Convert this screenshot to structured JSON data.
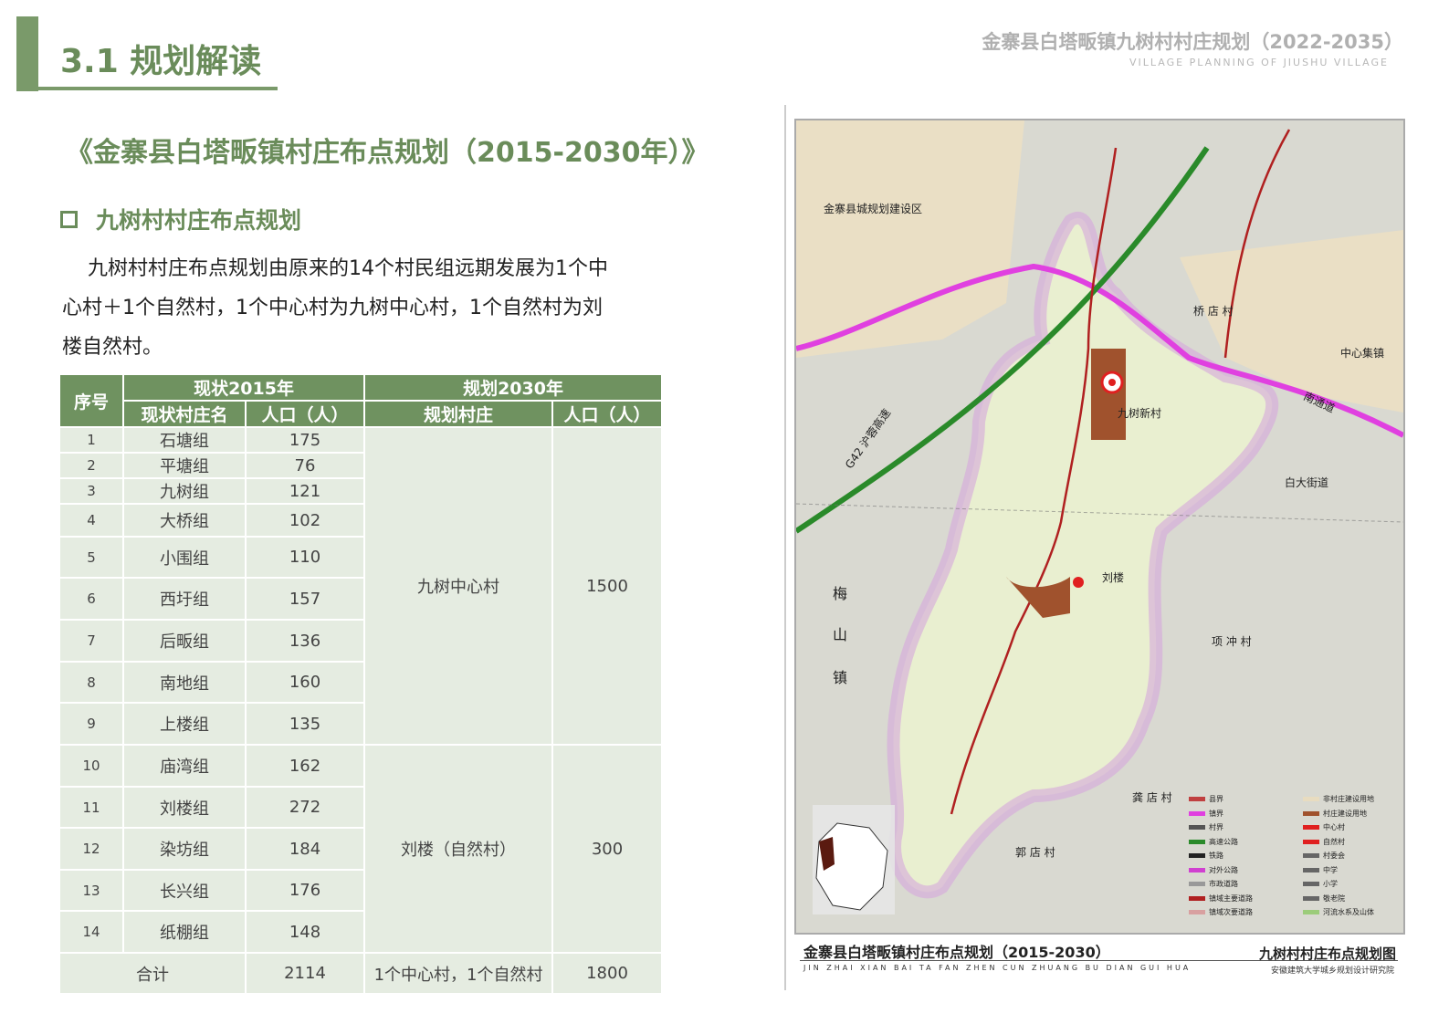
{
  "header": {
    "section_title": "3.1 规划解读",
    "doc_title": "金寨县白塔畈镇九树村村庄规划（2022-2035）",
    "doc_subtitle": "VILLAGE PLANNING OF JIUSHU VILLAGE"
  },
  "main_title": "《金寨县白塔畈镇村庄布点规划（2015-2030年）》",
  "sub_heading": "九树村村庄布点规划",
  "paragraph": {
    "line1": "九树村村庄布点规划由原来的14个村民组远期发展为1个中",
    "line2": "心村＋1个自然村，1个中心村为九树中心村，1个自然村为刘",
    "line3": "楼自然村。"
  },
  "table": {
    "headers": {
      "index": "序号",
      "current_group": "现状2015年",
      "planned_group": "规划2030年",
      "current_name": "现状村庄名",
      "current_pop": "人口（人）",
      "planned_name": "规划村庄",
      "planned_pop": "人口（人）"
    },
    "rows": [
      {
        "idx": "1",
        "name": "石塘组",
        "pop": "175"
      },
      {
        "idx": "2",
        "name": "平塘组",
        "pop": "76"
      },
      {
        "idx": "3",
        "name": "九树组",
        "pop": "121"
      },
      {
        "idx": "4",
        "name": "大桥组",
        "pop": "102"
      },
      {
        "idx": "5",
        "name": "小围组",
        "pop": "110"
      },
      {
        "idx": "6",
        "name": "西圩组",
        "pop": "157"
      },
      {
        "idx": "7",
        "name": "后畈组",
        "pop": "136"
      },
      {
        "idx": "8",
        "name": "南地组",
        "pop": "160"
      },
      {
        "idx": "9",
        "name": "上楼组",
        "pop": "135"
      },
      {
        "idx": "10",
        "name": "庙湾组",
        "pop": "162"
      },
      {
        "idx": "11",
        "name": "刘楼组",
        "pop": "272"
      },
      {
        "idx": "12",
        "name": "染坊组",
        "pop": "184"
      },
      {
        "idx": "13",
        "name": "长兴组",
        "pop": "176"
      },
      {
        "idx": "14",
        "name": "纸棚组",
        "pop": "148"
      }
    ],
    "planned": [
      {
        "name": "九树中心村",
        "pop": "1500"
      },
      {
        "name": "刘楼（自然村）",
        "pop": "300"
      }
    ],
    "total": {
      "label": "合计",
      "pop": "2114",
      "planned_name": "1个中心村，1个自然村",
      "planned_pop": "1800"
    }
  },
  "map": {
    "labels": {
      "county_area": "金寨县城规划建设区",
      "qiaodian": "桥 店 村",
      "zhongxinji": "中心集镇",
      "nantong": "南通道",
      "jiushu_new": "九树新村",
      "baida": "白大街道",
      "liulou": "刘楼",
      "xiangchong": "项 冲 村",
      "gongdian": "龚 店 村",
      "guodian": "郭 店 村",
      "g42": "G42 沪蓉高速",
      "meishan_1": "梅",
      "meishan_2": "山",
      "meishan_3": "镇"
    },
    "legend": [
      {
        "label": "县界",
        "color": "#c04040"
      },
      {
        "label": "镇界",
        "color": "#e040e0"
      },
      {
        "label": "村界",
        "color": "#555555"
      },
      {
        "label": "高速公路",
        "color": "#2a8a2a"
      },
      {
        "label": "铁路",
        "color": "#222222"
      },
      {
        "label": "对外公路",
        "color": "#d040d0"
      },
      {
        "label": "市政道路",
        "color": "#999999"
      },
      {
        "label": "镇域主要道路",
        "color": "#b02020"
      },
      {
        "label": "镇域次要道路",
        "color": "#d8a0a0"
      },
      {
        "label": "非村庄建设用地",
        "color": "#e8dcc0"
      },
      {
        "label": "村庄建设用地",
        "color": "#a0522d"
      },
      {
        "label": "中心村",
        "color": "#e02020"
      },
      {
        "label": "自然村",
        "color": "#e02020"
      },
      {
        "label": "村委会",
        "color": "#666666"
      },
      {
        "label": "中学",
        "color": "#666666"
      },
      {
        "label": "小学",
        "color": "#666666"
      },
      {
        "label": "敬老院",
        "color": "#666666"
      },
      {
        "label": "河流水系及山体",
        "color": "#9ccc7a"
      }
    ],
    "footer_title": "金寨县白塔畈镇村庄布点规划（2015-2030）",
    "footer_pinyin": "JIN ZHAI XIAN BAI TA FAN ZHEN CUN ZHUANG BU DIAN GUI HUA",
    "map_name": "九树村村庄布点规划图",
    "institute": "安徽建筑大学城乡规划设计研究院"
  }
}
